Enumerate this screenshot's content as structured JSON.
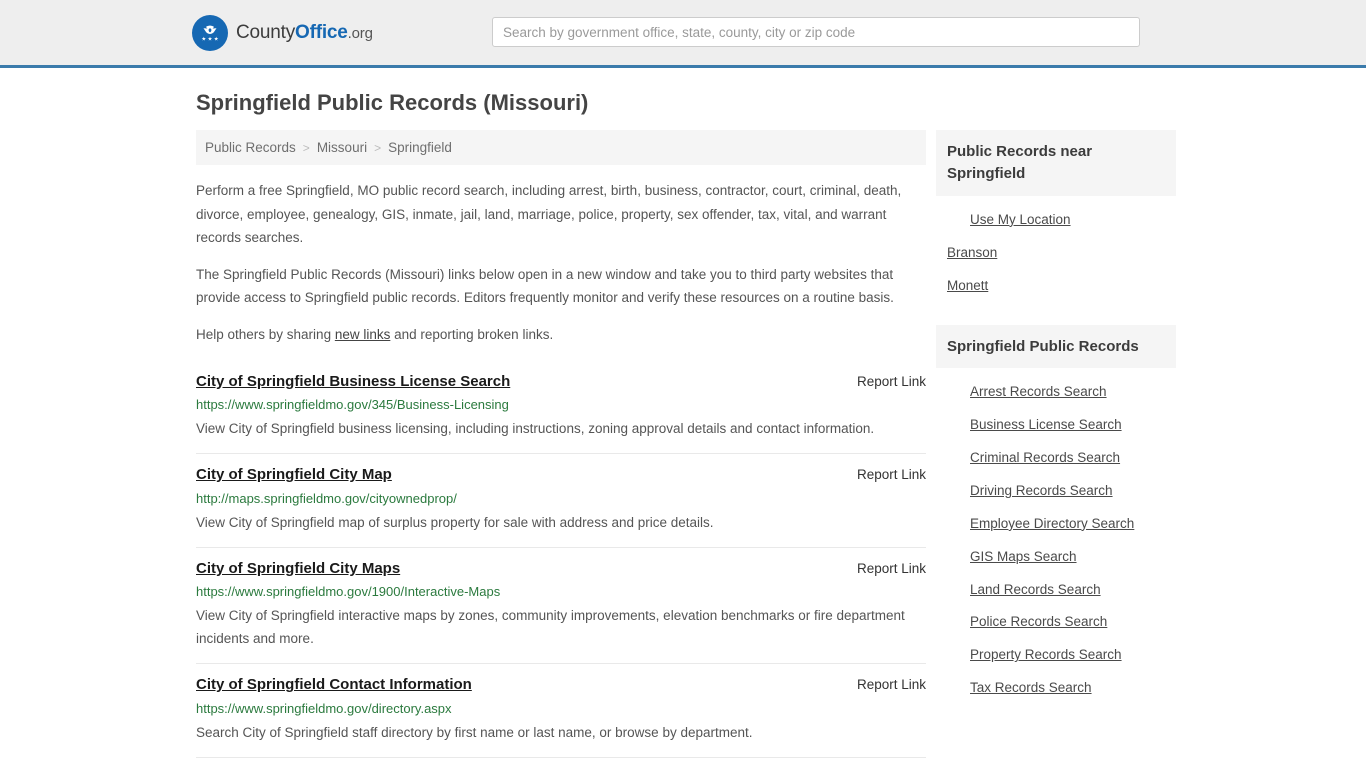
{
  "header": {
    "brand": {
      "part1": "County",
      "part2": "Office",
      "part3": ".org",
      "logo_icon": "eagle-stars-icon"
    },
    "search": {
      "placeholder": "Search by government office, state, county, city or zip code",
      "value": ""
    }
  },
  "colors": {
    "accent_blue": "#3b7bab",
    "logo_blue": "#1668b3",
    "url_green": "#2b7a3e",
    "header_bg": "#eeeeee",
    "panel_bg": "#f5f5f5"
  },
  "page": {
    "title": "Springfield Public Records (Missouri)"
  },
  "breadcrumb": {
    "items": [
      "Public Records",
      "Missouri",
      "Springfield"
    ],
    "separator": ">"
  },
  "intro": {
    "paragraph1": "Perform a free Springfield, MO public record search, including arrest, birth, business, contractor, court, criminal, death, divorce, employee, genealogy, GIS, inmate, jail, land, marriage, police, property, sex offender, tax, vital, and warrant records searches.",
    "paragraph2": "The Springfield Public Records (Missouri) links below open in a new window and take you to third party websites that provide access to Springfield public records. Editors frequently monitor and verify these resources on a routine basis.",
    "paragraph3_before": "Help others by sharing ",
    "paragraph3_link": "new links",
    "paragraph3_after": " and reporting broken links."
  },
  "results": {
    "report_label": "Report Link",
    "items": [
      {
        "title": "City of Springfield Business License Search",
        "url": "https://www.springfieldmo.gov/345/Business-Licensing",
        "description": "View City of Springfield business licensing, including instructions, zoning approval details and contact information."
      },
      {
        "title": "City of Springfield City Map",
        "url": "http://maps.springfieldmo.gov/cityownedprop/",
        "description": "View City of Springfield map of surplus property for sale with address and price details."
      },
      {
        "title": "City of Springfield City Maps",
        "url": "https://www.springfieldmo.gov/1900/Interactive-Maps",
        "description": "View City of Springfield interactive maps by zones, community improvements, elevation benchmarks or fire department incidents and more."
      },
      {
        "title": "City of Springfield Contact Information",
        "url": "https://www.springfieldmo.gov/directory.aspx",
        "description": "Search City of Springfield staff directory by first name or last name, or browse by department."
      }
    ]
  },
  "sidebar": {
    "nearby": {
      "heading": "Public Records near Springfield",
      "items": [
        {
          "label": "Use My Location",
          "indented": true
        },
        {
          "label": "Branson",
          "indented": false
        },
        {
          "label": "Monett",
          "indented": false
        }
      ]
    },
    "records": {
      "heading": "Springfield Public Records",
      "items": [
        {
          "label": "Arrest Records Search"
        },
        {
          "label": "Business License Search"
        },
        {
          "label": "Criminal Records Search"
        },
        {
          "label": "Driving Records Search"
        },
        {
          "label": "Employee Directory Search"
        },
        {
          "label": "GIS Maps Search"
        },
        {
          "label": "Land Records Search"
        },
        {
          "label": "Police Records Search"
        },
        {
          "label": "Property Records Search"
        },
        {
          "label": "Tax Records Search"
        }
      ]
    }
  }
}
